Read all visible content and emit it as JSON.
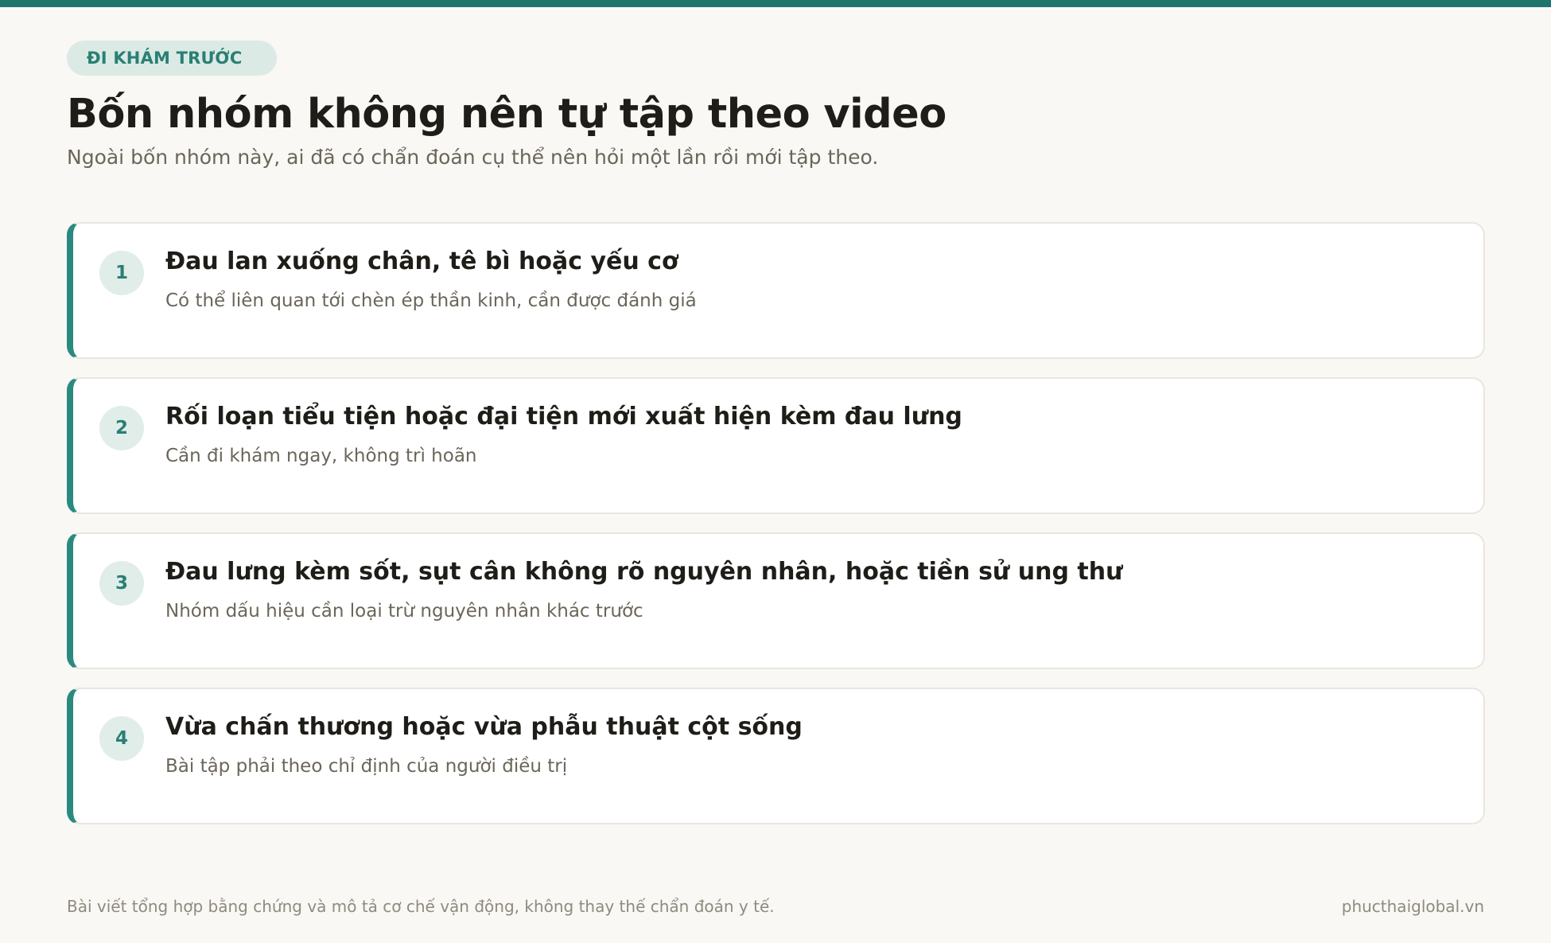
{
  "colors": {
    "accent": "#1e756e",
    "card_border_left": "#2a8a80",
    "badge_bg": "#dbeae5",
    "background": "#f9f8f5"
  },
  "badge": {
    "label": "ĐI KHÁM TRƯỚC"
  },
  "header": {
    "title": "Bốn nhóm không nên tự tập theo video",
    "subtitle": "Ngoài bốn nhóm này, ai đã có chẩn đoán cụ thể nên hỏi một lần rồi mới tập theo."
  },
  "cards": [
    {
      "number": "1",
      "title": "Đau lan xuống chân, tê bì hoặc yếu cơ",
      "description": "Có thể liên quan tới chèn ép thần kinh, cần được đánh giá"
    },
    {
      "number": "2",
      "title": "Rối loạn tiểu tiện hoặc đại tiện mới xuất hiện kèm đau lưng",
      "description": "Cần đi khám ngay, không trì hoãn"
    },
    {
      "number": "3",
      "title": "Đau lưng kèm sốt, sụt cân không rõ nguyên nhân, hoặc tiền sử ung thư",
      "description": "Nhóm dấu hiệu cần loại trừ nguyên nhân khác trước"
    },
    {
      "number": "4",
      "title": "Vừa chấn thương hoặc vừa phẫu thuật cột sống",
      "description": "Bài tập phải theo chỉ định của người điều trị"
    }
  ],
  "footer": {
    "disclaimer": "Bài viết tổng hợp bằng chứng và mô tả cơ chế vận động, không thay thế chẩn đoán y tế.",
    "site": "phucthaiglobal.vn"
  }
}
